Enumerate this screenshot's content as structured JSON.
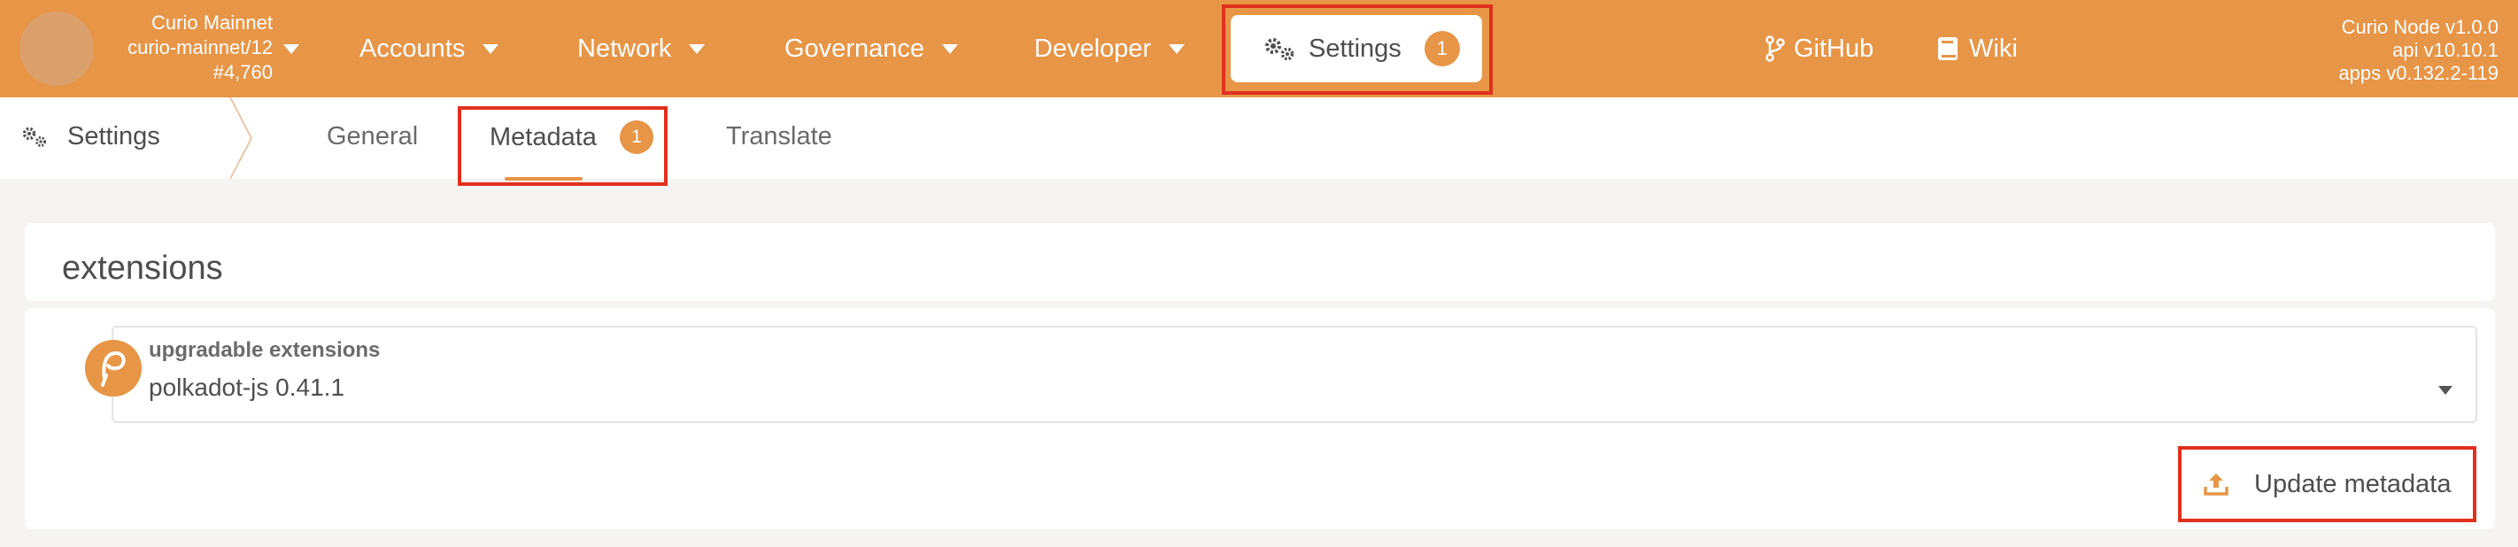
{
  "chain": {
    "name": "Curio Mainnet",
    "spec": "curio-mainnet/12",
    "block": "#4,760"
  },
  "nav": {
    "accounts": "Accounts",
    "network": "Network",
    "governance": "Governance",
    "developer": "Developer",
    "settings": "Settings",
    "settings_badge": "1",
    "github": "GitHub",
    "wiki": "Wiki"
  },
  "version": {
    "node": "Curio Node v1.0.0",
    "api": "api v10.10.1",
    "apps": "apps v0.132.2-119"
  },
  "subnav": {
    "title": "Settings",
    "tabs": [
      {
        "label": "General"
      },
      {
        "label": "Metadata",
        "badge": "1"
      },
      {
        "label": "Translate"
      }
    ]
  },
  "section": {
    "title": "extensions"
  },
  "extension_select": {
    "label": "upgradable extensions",
    "value": "polkadot-js 0.41.1"
  },
  "update_button": {
    "label": "Update metadata"
  },
  "colors": {
    "accent": "#e79546",
    "highlight": "#e0301e"
  }
}
